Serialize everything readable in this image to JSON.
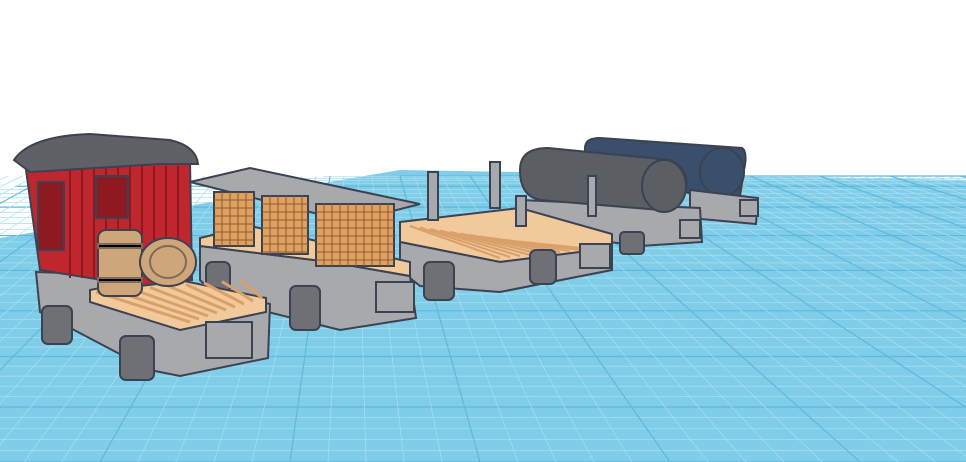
{
  "viewport": {
    "background": "#ffffff"
  },
  "workplane": {
    "fill": "#7fcde8",
    "line_minor": "#a9def0",
    "line_major": "#5fb9dc"
  },
  "models": [
    {
      "name": "caboose-car",
      "icon": "caboose-icon"
    },
    {
      "name": "barrel-crate-car",
      "icon": "crate-car-icon"
    },
    {
      "name": "stake-flat-car",
      "icon": "flatcar-icon"
    },
    {
      "name": "tank-car",
      "icon": "tank-car-icon"
    },
    {
      "name": "rear-tank-car",
      "icon": "tank-car-icon"
    }
  ],
  "colors": {
    "chassis": "#a8a9ad",
    "chassis_dark": "#6f7075",
    "outline": "#3b4252",
    "deck": "#f1c99a",
    "deck_slat": "#d9a06a",
    "cab_red": "#c0262d",
    "cab_red_dark": "#8c1a20",
    "roof": "#5f6167",
    "barrel": "#cfa57a",
    "barrel_band": "#7c6a5a",
    "crate": "#e0a060",
    "crate_grid": "#8a5a34",
    "tank": "#5b5e63",
    "tank_blue": "#3a4f6b"
  }
}
